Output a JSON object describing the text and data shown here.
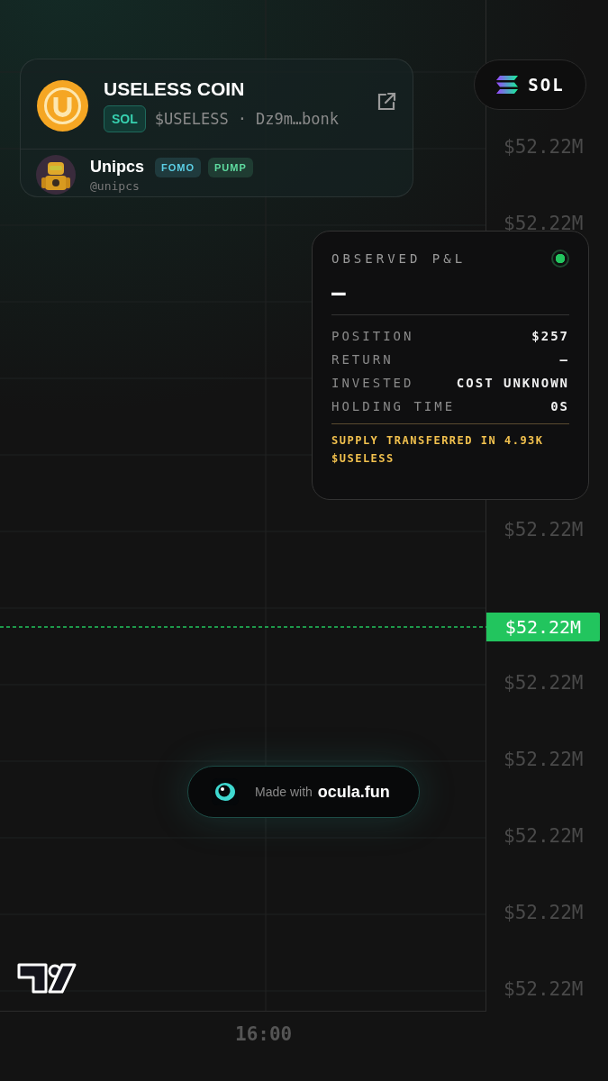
{
  "token": {
    "name": "USELESS COIN",
    "chain_badge": "SOL",
    "ticker": "$USELESS",
    "separator": "·",
    "address": "Dz9m…bonk"
  },
  "creator": {
    "name": "Unipcs",
    "handle": "@unipcs",
    "tags": [
      {
        "label": "FOMO",
        "color": "#5ccfe6"
      },
      {
        "label": "PUMP",
        "color": "#5fdca0"
      }
    ]
  },
  "network": {
    "label": "SOL"
  },
  "pnl": {
    "title": "OBSERVED P&L",
    "live": true,
    "value": "—",
    "rows": [
      {
        "label": "POSITION",
        "value": "$257"
      },
      {
        "label": "RETURN",
        "value": "–"
      },
      {
        "label": "INVESTED",
        "value": "COST UNKNOWN"
      },
      {
        "label": "HOLDING TIME",
        "value": "0S"
      }
    ],
    "note": "SUPPLY TRANSFERRED IN 4.93K $USELESS"
  },
  "chart": {
    "price_labels": [
      "$52.22M",
      "$52.22M",
      "$52.22M",
      "$52.22M",
      "$52.22M",
      "$52.22M",
      "$52.22M",
      "$52.22M"
    ],
    "current_price": "$52.22M",
    "time_label": "16:00"
  },
  "badge": {
    "prefix": "Made with",
    "brand": "ocula.fun"
  }
}
